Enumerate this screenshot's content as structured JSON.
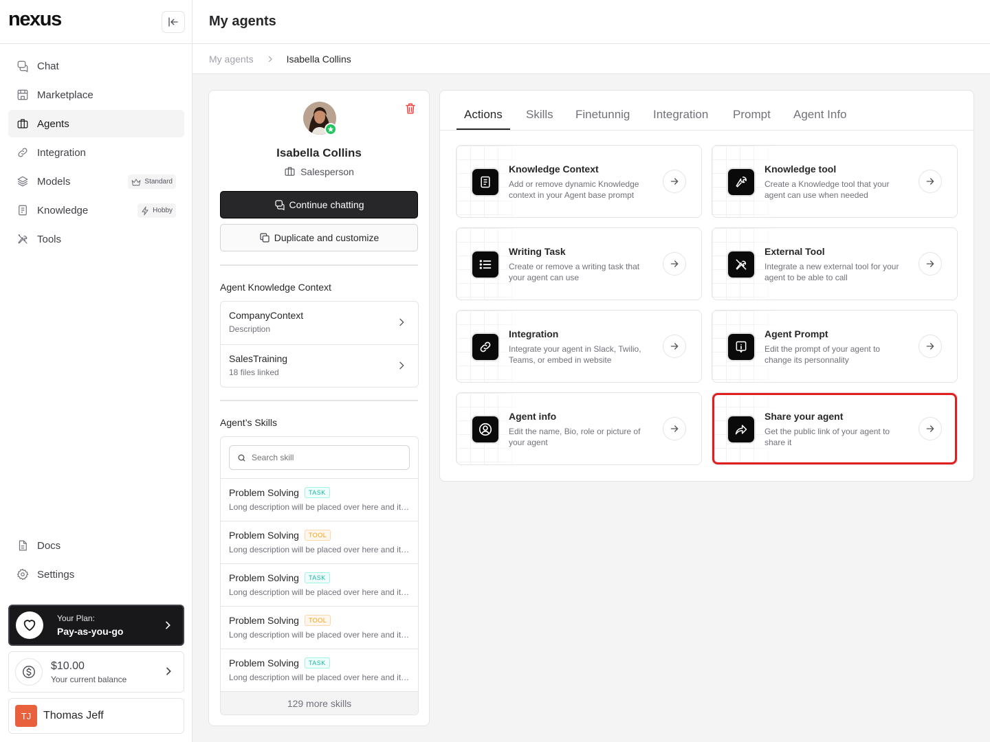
{
  "brand": {
    "logo": "nexus"
  },
  "sidebar": {
    "items": [
      {
        "label": "Chat",
        "icon": "chat-icon"
      },
      {
        "label": "Marketplace",
        "icon": "store-icon"
      },
      {
        "label": "Agents",
        "icon": "briefcase-icon",
        "active": true
      },
      {
        "label": "Integration",
        "icon": "link-icon"
      },
      {
        "label": "Models",
        "icon": "layers-icon",
        "badge": "Standard"
      },
      {
        "label": "Knowledge",
        "icon": "book-icon",
        "badge": "Hobby"
      },
      {
        "label": "Tools",
        "icon": "tools-icon"
      }
    ],
    "bottom_items": [
      {
        "label": "Docs",
        "icon": "doc-icon"
      },
      {
        "label": "Settings",
        "icon": "gear-icon"
      }
    ],
    "plan": {
      "caption": "Your Plan:",
      "name": "Pay-as-you-go"
    },
    "balance": {
      "amount": "$10.00",
      "caption": "Your current balance"
    },
    "user": {
      "initials": "TJ",
      "name": "Thomas Jeff"
    }
  },
  "header": {
    "title": "My agents"
  },
  "breadcrumb": {
    "parent": "My agents",
    "current": "Isabella Collins"
  },
  "agent": {
    "name": "Isabella Collins",
    "role": "Salesperson",
    "continue_label": "Continue chatting",
    "duplicate_label": "Duplicate and customize"
  },
  "knowledge_context": {
    "title": "Agent Knowledge Context",
    "items": [
      {
        "title": "CompanyContext",
        "desc": "Description"
      },
      {
        "title": "SalesTraining",
        "desc": "18 files linked"
      }
    ]
  },
  "skills": {
    "title": "Agent’s Skills",
    "search_placeholder": "Search skill",
    "items": [
      {
        "title": "Problem Solving",
        "tag": "TASK",
        "desc": "Long description will be placed over here and it can be a long one"
      },
      {
        "title": "Problem Solving",
        "tag": "TOOL",
        "desc": "Long description will be placed over here and it can be a long one"
      },
      {
        "title": "Problem Solving",
        "tag": "TASK",
        "desc": "Long description will be placed over here and it can be a long one"
      },
      {
        "title": "Problem Solving",
        "tag": "TOOL",
        "desc": "Long description will be placed over here and it can be a long one"
      },
      {
        "title": "Problem Solving",
        "tag": "TASK",
        "desc": "Long description will be placed over here and it can be a long one"
      }
    ],
    "more_label": "129 more skills"
  },
  "tabs": [
    "Actions",
    "Skills",
    "Finetunnig",
    "Integration",
    "Prompt",
    "Agent Info"
  ],
  "actions": [
    {
      "title": "Knowledge Context",
      "desc": "Add or remove dynamic Knowledge context in your Agent base prompt",
      "icon": "document-icon"
    },
    {
      "title": "Knowledge tool",
      "desc": "Create a Knowledge tool that your agent can use when needed",
      "icon": "wrench-icon"
    },
    {
      "title": "Writing Task",
      "desc": "Create or remove a writing task that your agent can use",
      "icon": "list-icon"
    },
    {
      "title": "External Tool",
      "desc": "Integrate a new external tool for your agent to be able to call",
      "icon": "tools-icon"
    },
    {
      "title": "Integration",
      "desc": "Integrate your agent in Slack, Twilio, Teams, or embed in website",
      "icon": "link-icon"
    },
    {
      "title": "Agent Prompt",
      "desc": "Edit the prompt of your agent to change its personnality",
      "icon": "prompt-icon"
    },
    {
      "title": "Agent info",
      "desc": "Edit the name, Bio, role or picture of your agent",
      "icon": "user-circle-icon"
    },
    {
      "title": "Share your agent",
      "desc": "Get the public link of your agent to share it",
      "icon": "share-icon"
    }
  ],
  "colors": {
    "accent_dark": "#18181b",
    "danger": "#ef4444",
    "online": "#22c55e",
    "highlight": "#e11d1d",
    "task": "#14b8a6",
    "tool": "#f59e0b",
    "user_avatar": "#e8603c"
  }
}
